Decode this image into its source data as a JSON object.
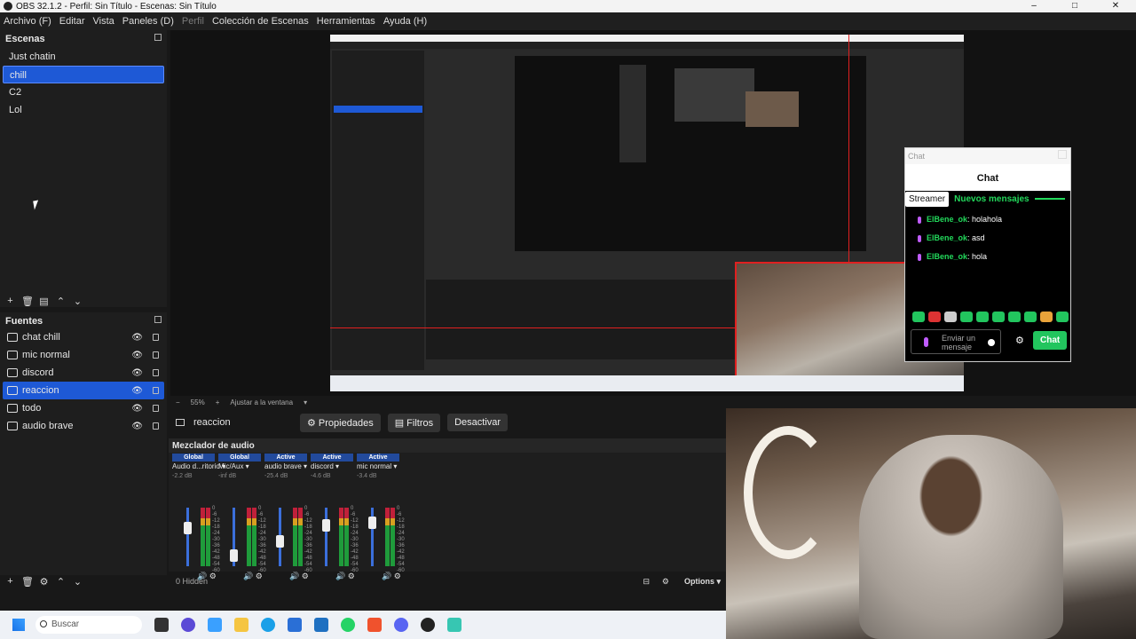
{
  "window": {
    "title": "OBS 32.1.2 - Perfil: Sin Título - Escenas: Sin Título"
  },
  "menu": [
    "Archivo (F)",
    "Editar",
    "Vista",
    "Paneles (D)",
    "Perfil",
    "Colección de Escenas",
    "Herramientas",
    "Ayuda (H)"
  ],
  "scenes": {
    "title": "Escenas",
    "items": [
      "Just chatin",
      "chill",
      "C2",
      "Lol"
    ],
    "selected": "chill"
  },
  "sources": {
    "title": "Fuentes",
    "items": [
      "chat chill",
      "mic normal",
      "discord",
      "reaccion",
      "todo",
      "audio brave"
    ],
    "selected": "reaccion"
  },
  "preview": {
    "zoom": "55%",
    "fit": "Ajustar a la ventana",
    "overlay_px": "690 px"
  },
  "chat": {
    "window_title": "Chat",
    "title": "Chat",
    "streamer_label": "Streamer",
    "new_messages": "Nuevos mensajes",
    "messages": [
      {
        "user": "ElBene_ok",
        "text": ": holahola"
      },
      {
        "user": "ElBene_ok",
        "text": ": asd"
      },
      {
        "user": "ElBene_ok",
        "text": ": hola"
      }
    ],
    "input_placeholder": "Enviar un mensaje",
    "send_label": "Chat",
    "colors": {
      "accent": "#22c55e",
      "mic": "#c05cff"
    }
  },
  "source_bar": {
    "current": "reaccion",
    "properties": "Propiedades",
    "filters": "Filtros",
    "deactivate": "Desactivar"
  },
  "mixer": {
    "title": "Mezclador de audio",
    "channels": [
      {
        "mode": "Global",
        "name": "Audio d...ritorio",
        "db": "-2.2 dB",
        "level": 0.7
      },
      {
        "mode": "Global",
        "name": "Mic/Aux",
        "db": "-inf dB",
        "level": 0.1
      },
      {
        "mode": "Active",
        "name": "audio brave",
        "db": "-25.4 dB",
        "level": 0.4
      },
      {
        "mode": "Active",
        "name": "discord",
        "db": "-4.6 dB",
        "level": 0.75
      },
      {
        "mode": "Active",
        "name": "mic normal",
        "db": "-3.4 dB",
        "level": 0.8
      }
    ],
    "scale": [
      "0",
      "-6",
      "-12",
      "-18",
      "-24",
      "-30",
      "-36",
      "-42",
      "-48",
      "-54",
      "-60"
    ],
    "hidden": "0 Hidden",
    "options": "Options"
  },
  "taskbar": {
    "search": "Buscar"
  }
}
